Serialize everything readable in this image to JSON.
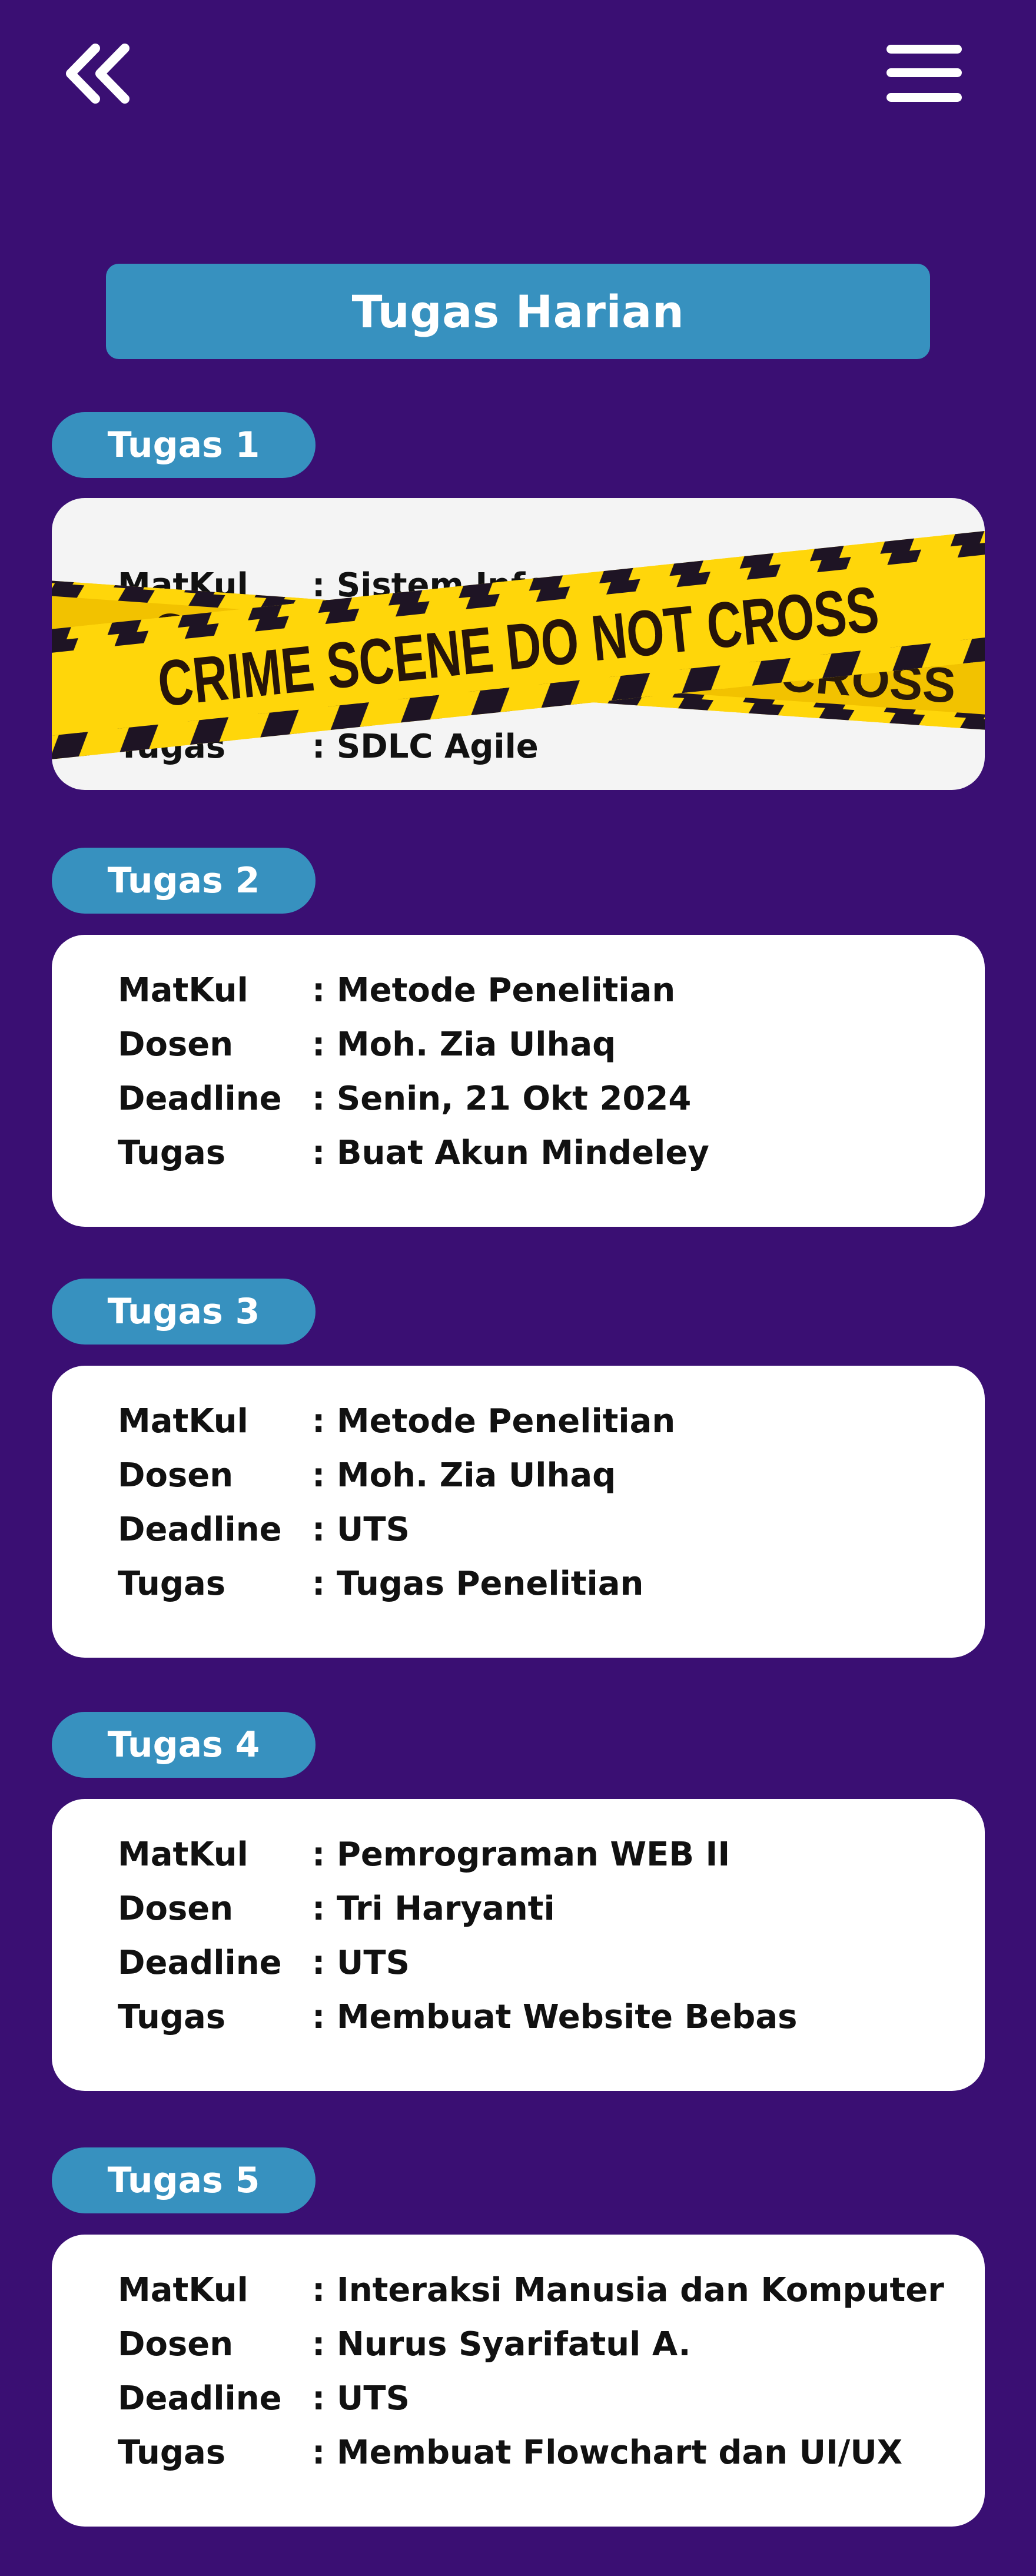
{
  "header": {
    "back_icon": "double-chevron-left-icon",
    "menu_icon": "hamburger-menu-icon"
  },
  "page": {
    "title": "Tugas Harian"
  },
  "labels": {
    "matkul": "MatKul",
    "dosen": "Dosen",
    "deadline": "Deadline",
    "tugas": "Tugas"
  },
  "tasks": [
    {
      "badge": "Tugas 1",
      "matkul_value": ": Sistem Informasi",
      "tugas_value": ": SDLC Agile",
      "overlay": {
        "text_main": "CRIME SCENE DO NOT CROSS",
        "text_back_left": "CRIM",
        "text_back_right": "CROSS"
      }
    },
    {
      "badge": "Tugas 2",
      "matkul_value": ": Metode Penelitian",
      "dosen_value": ": Moh. Zia Ulhaq",
      "deadline_value": ": Senin, 21 Okt 2024",
      "tugas_value": ": Buat Akun Mindeley"
    },
    {
      "badge": "Tugas 3",
      "matkul_value": ": Metode Penelitian",
      "dosen_value": ": Moh. Zia Ulhaq",
      "deadline_value": ": UTS",
      "tugas_value": ": Tugas Penelitian"
    },
    {
      "badge": "Tugas 4",
      "matkul_value": ": Pemrograman WEB II",
      "dosen_value": ": Tri Haryanti",
      "deadline_value": ": UTS",
      "tugas_value": ": Membuat Website Bebas"
    },
    {
      "badge": "Tugas 5",
      "matkul_value": ": Interaksi Manusia dan Komputer",
      "dosen_value": ": Nurus Syarifatul A.",
      "deadline_value": ": UTS",
      "tugas_value": ": Membuat Flowchart dan UI/UX"
    }
  ],
  "colors": {
    "background": "#3a0f73",
    "accent": "#3791bf",
    "card": "#ffffff",
    "tape_yellow": "#ffd60a",
    "tape_dark": "#1e1424"
  }
}
